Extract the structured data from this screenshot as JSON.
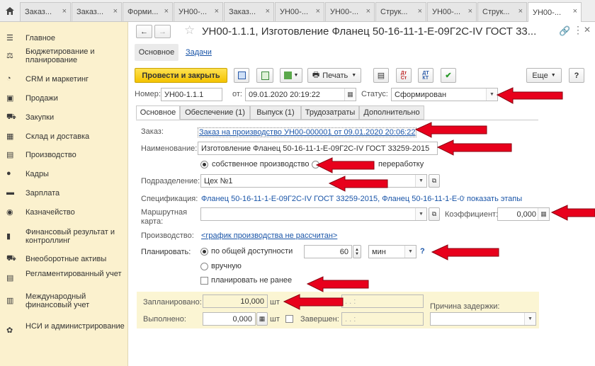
{
  "tabs": [
    {
      "label": "Заказ..."
    },
    {
      "label": "Заказ..."
    },
    {
      "label": "Форми..."
    },
    {
      "label": "УН00-..."
    },
    {
      "label": "Заказ..."
    },
    {
      "label": "УН00-..."
    },
    {
      "label": "УН00-..."
    },
    {
      "label": "Струк..."
    },
    {
      "label": "УН00-..."
    },
    {
      "label": "Струк..."
    },
    {
      "label": "УН00-..."
    }
  ],
  "sidebar": [
    {
      "label": "Главное",
      "icon": "menu-icon"
    },
    {
      "label": "Бюджетирование и планирование",
      "icon": "budget-icon"
    },
    {
      "label": "CRM и маркетинг",
      "icon": "pie-icon"
    },
    {
      "label": "Продажи",
      "icon": "bag-icon"
    },
    {
      "label": "Закупки",
      "icon": "cart-icon"
    },
    {
      "label": "Склад и доставка",
      "icon": "warehouse-icon"
    },
    {
      "label": "Производство",
      "icon": "factory-icon"
    },
    {
      "label": "Кадры",
      "icon": "person-icon"
    },
    {
      "label": "Зарплата",
      "icon": "money-icon"
    },
    {
      "label": "Казначейство",
      "icon": "coin-icon"
    },
    {
      "label": "Финансовый результат и контроллинг",
      "icon": "chart-icon"
    },
    {
      "label": "Внеоборотные активы",
      "icon": "assets-icon"
    },
    {
      "label": "Регламентированный учет",
      "icon": "ledger-icon"
    },
    {
      "label": "Международный финансовый учет",
      "icon": "intl-icon"
    },
    {
      "label": "НСИ и администрирование",
      "icon": "gear-icon"
    }
  ],
  "header": {
    "title": "УН00-1.1.1, Изготовление Фланец 50-16-11-1-Е-09Г2С-IV ГОСТ 33..."
  },
  "subnav": {
    "main": "Основное",
    "tasks": "Задачи"
  },
  "toolbar": {
    "post_close": "Провести и закрыть",
    "print": "Печать",
    "more": "Еще",
    "help": "?"
  },
  "doc": {
    "number_label": "Номер:",
    "number": "УН00-1.1.1",
    "date_label": "от:",
    "date": "09.01.2020 20:19:22",
    "status_label": "Статус:",
    "status": "Сформирован"
  },
  "formtabs": [
    "Основное",
    "Обеспечение (1)",
    "Выпуск (1)",
    "Трудозатраты",
    "Дополнительно"
  ],
  "form": {
    "order_label": "Заказ:",
    "order": "Заказ на производство УН00-000001 от 09.01.2020 20:06:22",
    "name_label": "Наименование:",
    "name": "Изготовление Фланец 50-16-11-1-Е-09Г2С-IV ГОСТ 33259-2015",
    "own_prod": "собственное производство",
    "processing": "переработку",
    "dept_label": "Подразделение:",
    "dept": "Цех №1",
    "spec_label": "Спецификация:",
    "spec": "Фланец 50-16-11-1-Е-09Г2С-IV ГОСТ 33259-2015, Фланец 50-16-11-1-Е-09...",
    "show_stages": "показать этапы",
    "route_label1": "Маршрутная",
    "route_label2": "карта:",
    "coef_label": "Коэффициент:",
    "coef": "0,000",
    "prod_label": "Производство:",
    "prod": "<график производства не рассчитан>",
    "plan_label": "Планировать:",
    "by_avail": "по общей доступности",
    "plan_value": "60",
    "plan_unit": "мин",
    "plan_help": "?",
    "manual": "вручную",
    "not_earlier": "планировать не ранее",
    "planned_label": "Запланировано:",
    "planned": "10,000",
    "unit": "шт",
    "planned_date": " .  .     :  ",
    "delay_label": "Причина задержки:",
    "done_label": "Выполнено:",
    "done": "0,000",
    "completed_label": "Завершен:",
    "completed_date": " .  .     :  "
  },
  "colors": {
    "accent": "#f4c300",
    "sidebar": "#fbf1ce",
    "link": "#1a55a8",
    "arrow": "#e8001c"
  }
}
